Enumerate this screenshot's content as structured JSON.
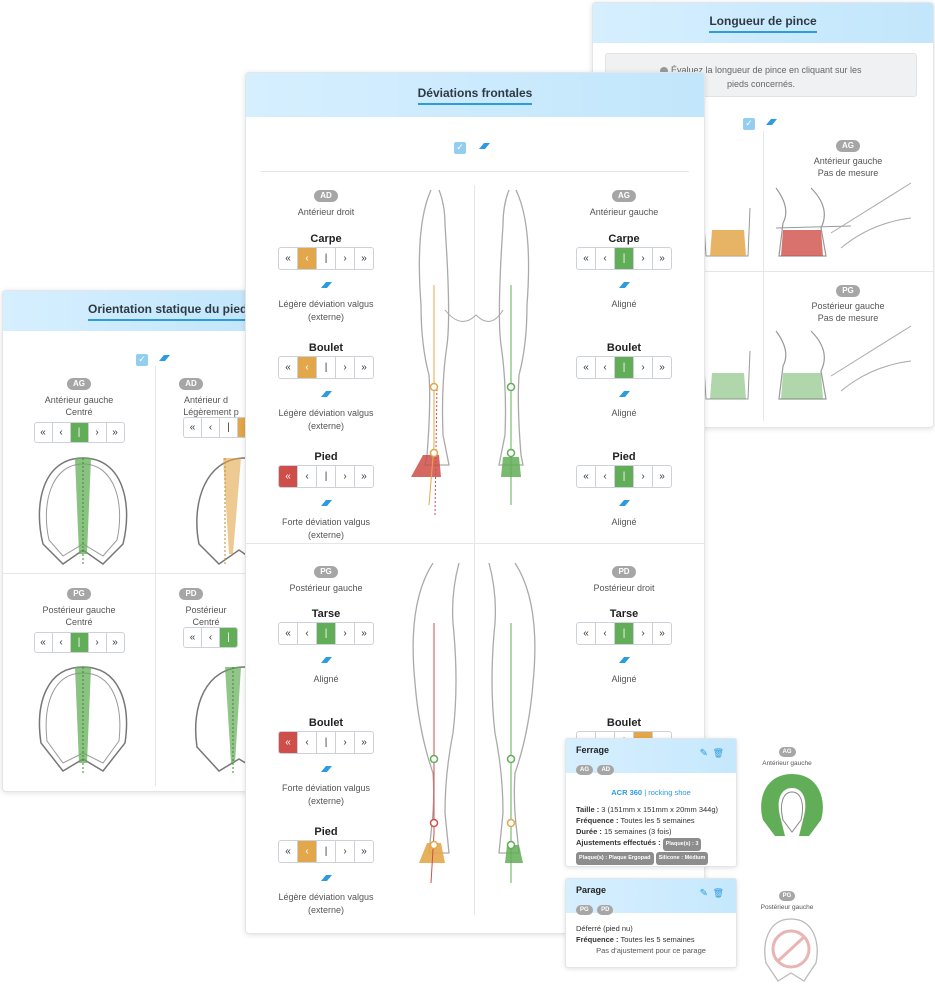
{
  "longueur": {
    "title": "Longueur de pince",
    "hint": "Évaluez la longueur de pince en cliquant sur les pieds concernés.",
    "feet": [
      {
        "badge": "AG",
        "name": "Antérieur gauche",
        "value": "Pas de mesure"
      },
      {
        "badge": "PG",
        "name": "Postérieur gauche",
        "value": "Pas de mesure"
      }
    ]
  },
  "orientation": {
    "title": "Orientation statique du pied",
    "feet": [
      {
        "badge": "AG",
        "name": "Antérieur gauche",
        "value": "Centré"
      },
      {
        "badge": "AD",
        "name": "Antérieur d",
        "value": "Légèrement p"
      },
      {
        "badge": "PG",
        "name": "Postérieur gauche",
        "value": "Centré"
      },
      {
        "badge": "PD",
        "name": "Postérieur",
        "value": "Centré"
      }
    ]
  },
  "deviations": {
    "title": "Déviations frontales",
    "limbs": {
      "ad": {
        "badge": "AD",
        "name": "Antérieur droit"
      },
      "ag": {
        "badge": "AG",
        "name": "Antérieur gauche"
      },
      "pg": {
        "badge": "PG",
        "name": "Postérieur gauche"
      },
      "pd": {
        "badge": "PD",
        "name": "Postérieur droit"
      }
    },
    "joints": {
      "ad_carpe": {
        "name": "Carpe",
        "desc1": "Légère déviation valgus",
        "desc2": "(externe)"
      },
      "ad_boulet": {
        "name": "Boulet",
        "desc1": "Légère déviation valgus",
        "desc2": "(externe)"
      },
      "ad_pied": {
        "name": "Pied",
        "desc1": "Forte déviation valgus",
        "desc2": "(externe)"
      },
      "ag_carpe": {
        "name": "Carpe",
        "desc1": "Aligné",
        "desc2": ""
      },
      "ag_boulet": {
        "name": "Boulet",
        "desc1": "Aligné",
        "desc2": ""
      },
      "ag_pied": {
        "name": "Pied",
        "desc1": "Aligné",
        "desc2": ""
      },
      "pg_tarse": {
        "name": "Tarse",
        "desc1": "Aligné",
        "desc2": ""
      },
      "pg_boulet": {
        "name": "Boulet",
        "desc1": "Forte déviation valgus",
        "desc2": "(externe)"
      },
      "pg_pied": {
        "name": "Pied",
        "desc1": "Légère déviation valgus",
        "desc2": "(externe)"
      },
      "pd_tarse": {
        "name": "Tarse",
        "desc1": "Aligné",
        "desc2": ""
      },
      "pd_boulet": {
        "name": "Boulet",
        "desc1": "",
        "desc2": ""
      }
    },
    "selector_glyphs": [
      "«",
      "‹",
      "|",
      "›",
      "»"
    ]
  },
  "ferrage": {
    "title": "Ferrage",
    "feet": [
      "AG",
      "AD"
    ],
    "product": "ACR 360",
    "product_sub": "| rocking shoe",
    "rows": [
      {
        "k": "Taille :",
        "v": "3 (151mm x 151mm x 20mm 344g)"
      },
      {
        "k": "Fréquence :",
        "v": "Toutes les 5 semaines"
      },
      {
        "k": "Durée :",
        "v": "15 semaines (3 fois)"
      },
      {
        "k": "Ajustements effectués :",
        "v": ""
      }
    ],
    "tags": [
      "Plaque(s) : 3",
      "Plaque(s) : Plaque Ergopad",
      "Silicone : Médium"
    ],
    "side_badge": "AG",
    "side_name": "Antérieur gauche"
  },
  "parage": {
    "title": "Parage",
    "feet": [
      "PG",
      "PD"
    ],
    "line1": "Déferré (pied nu)",
    "freq_k": "Fréquence :",
    "freq_v": "Toutes les 5 semaines",
    "note": "Pas d'ajustement pour ce parage",
    "side_badge": "PG",
    "side_name": "Postérieur gauche"
  },
  "colors": {
    "green": "#62ad57",
    "orange": "#e3a74b",
    "red": "#cf4e49",
    "blue": "#2d9be0"
  }
}
